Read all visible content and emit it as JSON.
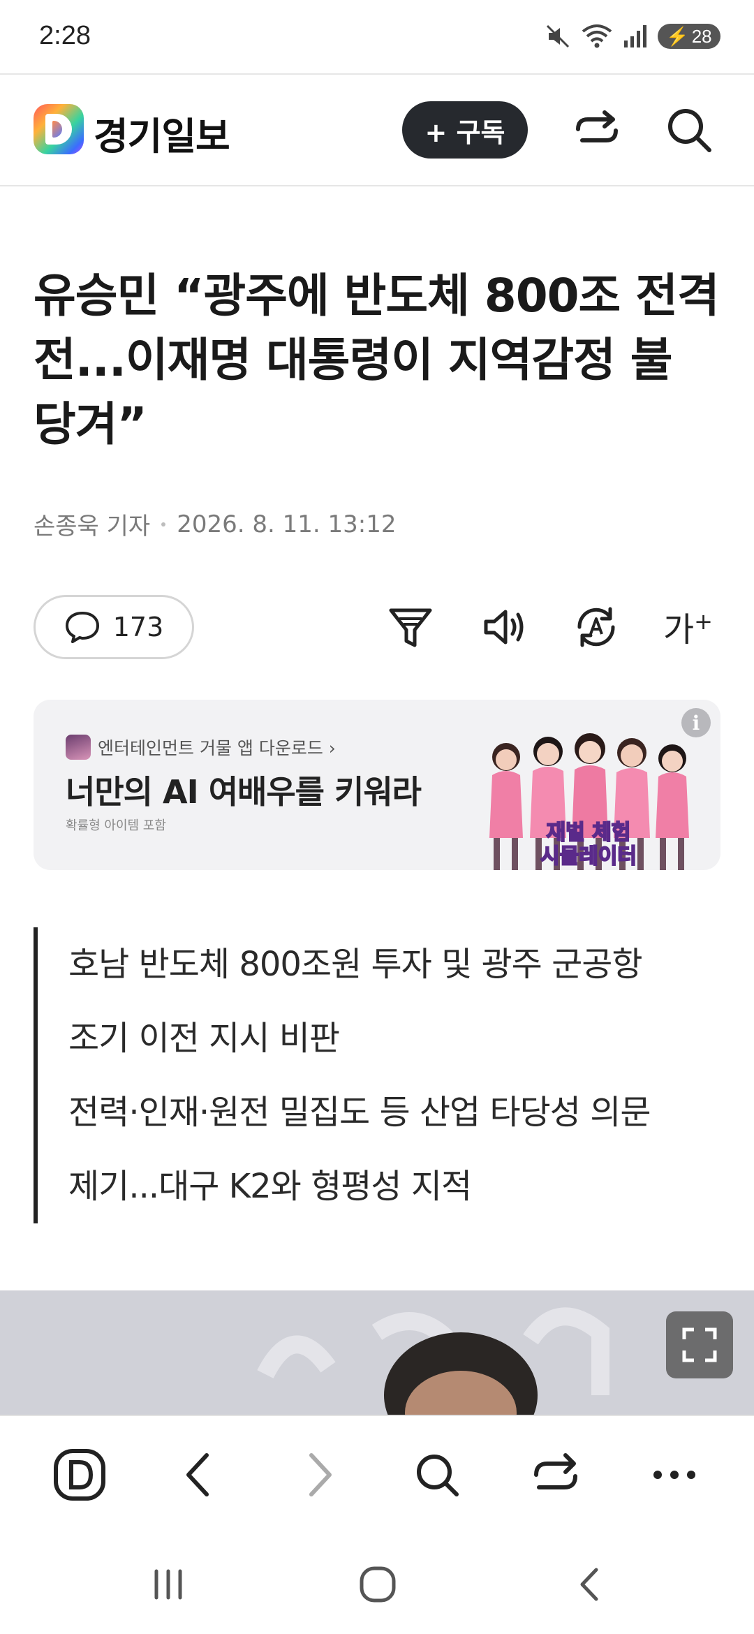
{
  "status_bar": {
    "time": "2:28",
    "battery_level": "28",
    "icons": [
      "mute-icon",
      "wifi-icon",
      "signal-icon",
      "battery-charging-icon"
    ]
  },
  "app_header": {
    "logo_text": "경기일보",
    "subscribe_label": "+ 구독",
    "icons": [
      "share-icon",
      "search-icon"
    ]
  },
  "article": {
    "headline": "유승민 “광주에 반도체 800조 전격전...이재명 대통령이 지역감정 불 당겨”",
    "author": "손종욱 기자",
    "datetime": "2026. 8. 11. 13:12",
    "comment_count": "173",
    "tools": [
      "filter-icon",
      "speaker-icon",
      "translate-icon",
      "font-size-icon"
    ],
    "font_size_label": "가",
    "summary": [
      "호남 반도체 800조원 투자 및 광주 군공항",
      "조기 이전 지시 비판",
      "전력·인재·원전 밀집도 등 산업 타당성 의문",
      "제기...대구 K2와 형평성 지적"
    ]
  },
  "ad": {
    "app_label": "엔터테인먼트 거물 앱 다운로드 ›",
    "title": "너만의 AI 여배우를 키워라",
    "note": "확률형 아이템 포함",
    "image_text_line1": "재벌 체험",
    "image_text_line2": "시뮬레이터",
    "info_label": "i"
  },
  "bottom_nav": {
    "items": [
      "daum-home-icon",
      "back-icon",
      "forward-icon",
      "search-icon",
      "share-icon",
      "more-icon"
    ]
  },
  "system_nav": {
    "items": [
      "recent-apps-icon",
      "home-icon",
      "system-back-icon"
    ]
  },
  "colors": {
    "subscribe_bg": "#26292e",
    "ad_bg": "#f2f2f4",
    "text": "#1a1a1a",
    "byline": "#7a7a7a"
  }
}
